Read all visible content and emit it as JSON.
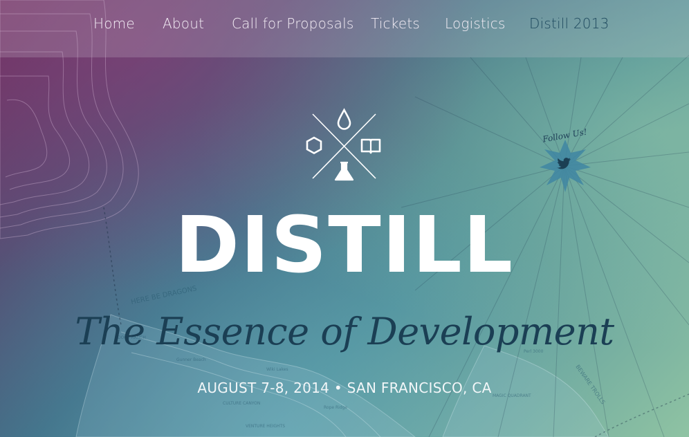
{
  "nav": {
    "items": [
      {
        "label": "Home"
      },
      {
        "label": "About"
      },
      {
        "label": "Call for Proposals"
      },
      {
        "label": "Tickets"
      },
      {
        "label": "Logistics"
      },
      {
        "label": "Distill 2013"
      }
    ]
  },
  "hero": {
    "title": "DISTILL",
    "tagline": "The Essence of Development",
    "date_location": "AUGUST 7-8, 2014 • SAN FRANCISCO, CA"
  },
  "social": {
    "follow_text": "Follow Us!",
    "icon": "twitter-icon"
  },
  "logo": {
    "icons": [
      "drop-icon",
      "hexagon-icon",
      "book-icon",
      "flask-icon"
    ]
  },
  "map_labels": [
    "HERE BE DRAGONS",
    "DOGE RANCH",
    "Gunner Beach",
    "Wiki Lakes",
    "CULTURE CANYON",
    "Rope Ridge",
    "VENTURE HEIGHTS",
    "MAGIC QUADRANT",
    "BEWARE TROLLS",
    "Perl 3000"
  ],
  "colors": {
    "accent_dark": "#1b3f54",
    "nav_text": "#f4eef6",
    "nav_alt_text": "#1f4a5f"
  }
}
